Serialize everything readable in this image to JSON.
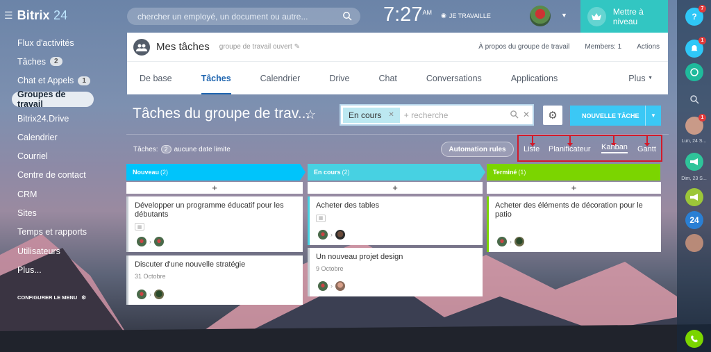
{
  "app": {
    "name": "Bitrix",
    "name_num": "24"
  },
  "sidebar": {
    "items": [
      {
        "label": "Flux d'activités"
      },
      {
        "label": "Tâches",
        "count": "2"
      },
      {
        "label": "Chat et Appels",
        "count": "1"
      },
      {
        "label": "Groupes de travail",
        "active": true
      },
      {
        "label": "Bitrix24.Drive"
      },
      {
        "label": "Calendrier"
      },
      {
        "label": "Courriel"
      },
      {
        "label": "Centre de contact"
      },
      {
        "label": "CRM"
      },
      {
        "label": "Sites"
      },
      {
        "label": "Temps et rapports"
      },
      {
        "label": "Utilisateurs"
      },
      {
        "label": "Plus..."
      }
    ],
    "configure": "CONFIGURER LE MENU"
  },
  "header": {
    "search_placeholder": "chercher un employé, un document ou autre...",
    "time": "7:27",
    "ampm": "AM",
    "status": "JE TRAVAILLE",
    "upgrade": "Mettre à niveau"
  },
  "right_bar": {
    "help_badge": "7",
    "notif_badge": "1",
    "contact_badge": "1",
    "date1": "Lun, 24 S...",
    "date2": "Dim, 23 S...",
    "logo24": "24"
  },
  "group": {
    "title": "Mes tâches",
    "subtitle": "groupe de travail ouvert",
    "about": "À propos du groupe de travail",
    "members": "Members: 1",
    "actions": "Actions",
    "tabs": [
      "De base",
      "Tâches",
      "Calendrier",
      "Drive",
      "Chat",
      "Conversations",
      "Applications"
    ],
    "active_tab": "Tâches",
    "more": "Plus"
  },
  "page": {
    "title": "Tâches du groupe de trav...",
    "filter_chip": "En cours",
    "filter_placeholder": "+ recherche",
    "new_task": "NOUVELLE TÂCHE"
  },
  "toolbar": {
    "stats_label": "Tâches:",
    "stats_count": "2",
    "stats_text": "aucune date limite",
    "automation": "Automation rules",
    "views": [
      "Liste",
      "Planificateur",
      "Kanban",
      "Gantt"
    ],
    "active_view": "Kanban"
  },
  "colors": {
    "accent": "#2066b0",
    "teal": "#32c6c2",
    "new": "#00c4fb",
    "progress": "#47d1e2",
    "done": "#7bd500",
    "highlight": "#d21a2a"
  },
  "columns": [
    {
      "title": "Nouveau",
      "count": "(2)",
      "cards": [
        {
          "title": "Développer un programme éducatif pour les débutants",
          "date": ""
        },
        {
          "title": "Discuter d'une nouvelle stratégie",
          "date": "31 Octobre"
        }
      ]
    },
    {
      "title": "En cours",
      "count": "(2)",
      "cards": [
        {
          "title": "Acheter des tables",
          "date": ""
        },
        {
          "title": "Un nouveau projet design",
          "date": "9 Octobre"
        }
      ]
    },
    {
      "title": "Terminé",
      "count": "(1)",
      "cards": [
        {
          "title": "Acheter des éléments de décoration pour le patio",
          "date": ""
        }
      ]
    }
  ]
}
